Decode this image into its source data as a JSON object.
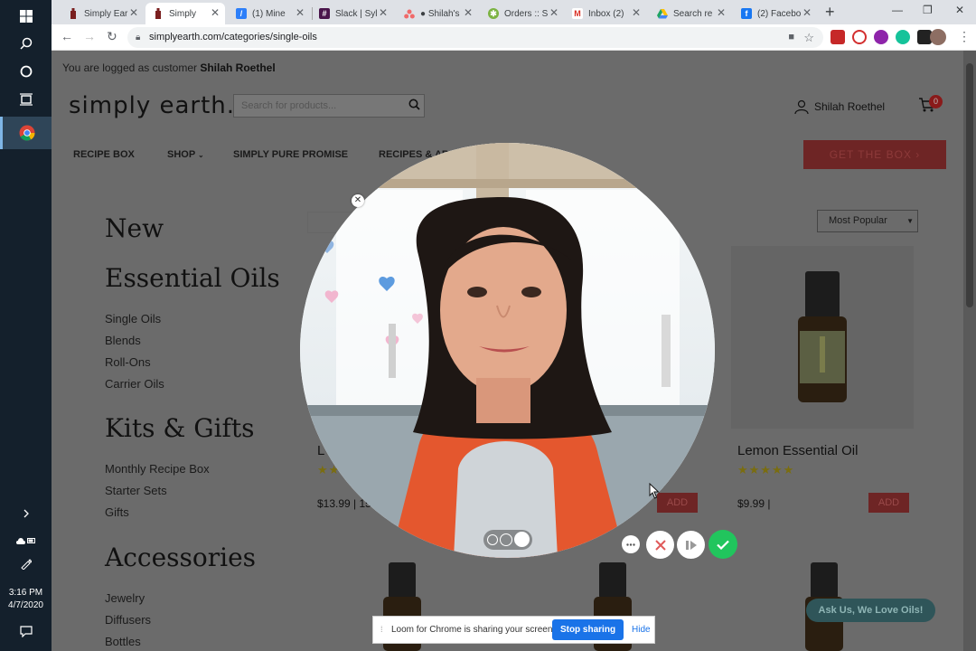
{
  "taskbar": {
    "time": "3:16 PM",
    "date": "4/7/2020"
  },
  "browser": {
    "tabs": [
      {
        "title": "Simply Ear",
        "icon": "bottle-icon",
        "color": "#7a1f1f"
      },
      {
        "title": "Simply",
        "icon": "bottle-icon",
        "color": "#7a1f1f",
        "active": true
      },
      {
        "title": "(1) Mine",
        "icon": "clickup-icon",
        "color": "#2d7ff9"
      },
      {
        "title": "Slack | Syl",
        "icon": "slack-icon",
        "color": "#4a154b"
      },
      {
        "title": "● Shilah's",
        "icon": "asana-icon",
        "color": "#f06a6a"
      },
      {
        "title": "Orders :: S",
        "icon": "gear-icon",
        "color": "#7cb342"
      },
      {
        "title": "Inbox (2)",
        "icon": "gmail-icon",
        "color": "#d93025"
      },
      {
        "title": "Search re",
        "icon": "drive-icon",
        "color": "#1fa463"
      },
      {
        "title": "(2) Facebo",
        "icon": "facebook-icon",
        "color": "#1877f2"
      }
    ],
    "url": "simplyearth.com/categories/single-oils"
  },
  "site": {
    "login_prefix": "You are logged as customer",
    "login_name": "Shilah Roethel",
    "logo": "simply earth.",
    "search_placeholder": "Search for products...",
    "user_name": "Shilah Roethel",
    "cart_count": "0",
    "nav": {
      "recipe_box": "RECIPE BOX",
      "shop": "SHOP",
      "promise": "SIMPLY PURE PROMISE",
      "recipes": "RECIPES & AR",
      "cta": "GET THE BOX ›"
    },
    "sidebar": {
      "new": "New",
      "essential_oils": "Essential Oils",
      "oils_links": [
        "Single Oils",
        "Blends",
        "Roll-Ons",
        "Carrier Oils"
      ],
      "kits_gifts": "Kits & Gifts",
      "kits_links": [
        "Monthly Recipe Box",
        "Starter Sets",
        "Gifts"
      ],
      "accessories": "Accessories",
      "acc_links": [
        "Jewelry",
        "Diffusers",
        "Bottles"
      ]
    },
    "sort_label": "Most Popular",
    "products": [
      {
        "name": "L",
        "price": "$13.99 | 15",
        "add": "ADD",
        "stars": "★★"
      },
      {
        "name": "",
        "price": "",
        "add": "ADD",
        "stars": ""
      },
      {
        "name": "Lemon Essential Oil",
        "price": "$9.99 |",
        "add": "ADD",
        "stars": "★★★★★"
      }
    ],
    "chat": "Ask Us, We Love Oils!"
  },
  "loom": {
    "share_message": "Loom for Chrome is sharing your screen.",
    "stop_label": "Stop sharing",
    "hide_label": "Hide"
  }
}
